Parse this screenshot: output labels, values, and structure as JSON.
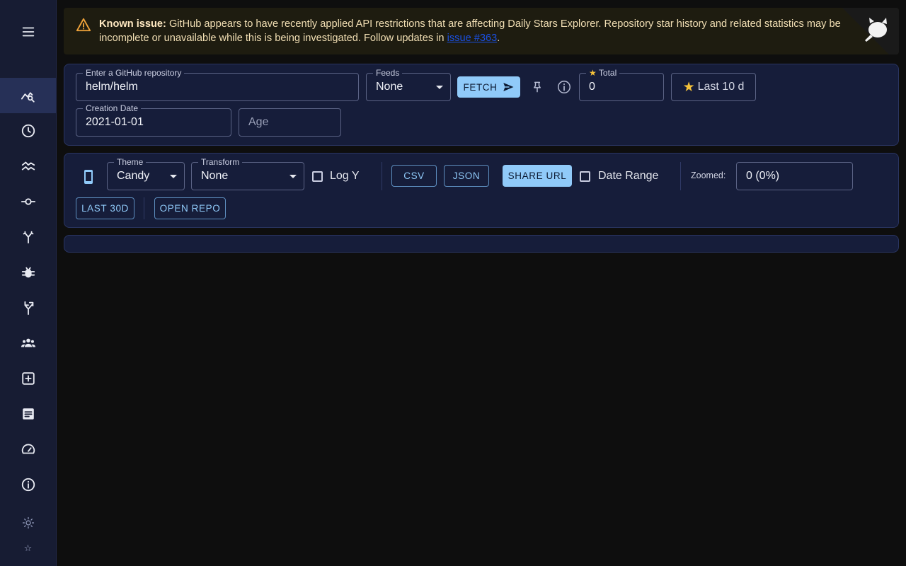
{
  "alert": {
    "title": "Known issue:",
    "message": "GitHub appears to have recently applied API restrictions that are affecting Daily Stars Explorer. Repository star history and related statistics may be incomplete or unavailable while this is being investigated. Follow updates in",
    "link_text": "issue #363",
    "end": "."
  },
  "sidebar": {
    "items": [
      {
        "icon": "menu-icon"
      },
      {
        "icon": "chart-search-icon",
        "active": true
      },
      {
        "icon": "clock-icon"
      },
      {
        "icon": "wave-chart-icon"
      },
      {
        "icon": "commit-icon"
      },
      {
        "icon": "merge-icon"
      },
      {
        "icon": "bug-icon"
      },
      {
        "icon": "fork-icon"
      },
      {
        "icon": "people-icon"
      },
      {
        "icon": "add-box-icon"
      },
      {
        "icon": "article-icon"
      },
      {
        "icon": "speedometer-icon"
      },
      {
        "icon": "info-icon"
      },
      {
        "icon": "sun-icon"
      },
      {
        "icon": "star-icon"
      }
    ],
    "star_glyph": "☆"
  },
  "repo_panel": {
    "repo_label": "Enter a GitHub repository",
    "repo_value": "helm/helm",
    "feeds_label": "Feeds",
    "feeds_value": "None",
    "fetch_label": "FETCH",
    "total_label": "Total",
    "total_value": "0",
    "last_button": "Last 10 d",
    "creation_label": "Creation Date",
    "creation_value": "2021-01-01",
    "age_placeholder": "Age"
  },
  "controls_panel": {
    "theme_label": "Theme",
    "theme_value": "Candy",
    "transform_label": "Transform",
    "transform_value": "None",
    "log_y": "Log Y",
    "csv": "CSV",
    "json": "JSON",
    "share_url": "SHARE URL",
    "date_range": "Date Range",
    "zoomed_label": "Zoomed:",
    "zoomed_value": "0 (0%)",
    "last_30d": "LAST 30D",
    "open_repo": "OPEN REPO"
  },
  "colors": {
    "accent": "#90caf9",
    "sidebar_bg": "#171c33",
    "panel_bg": "#161d3a",
    "warning": "#f0a33a"
  }
}
